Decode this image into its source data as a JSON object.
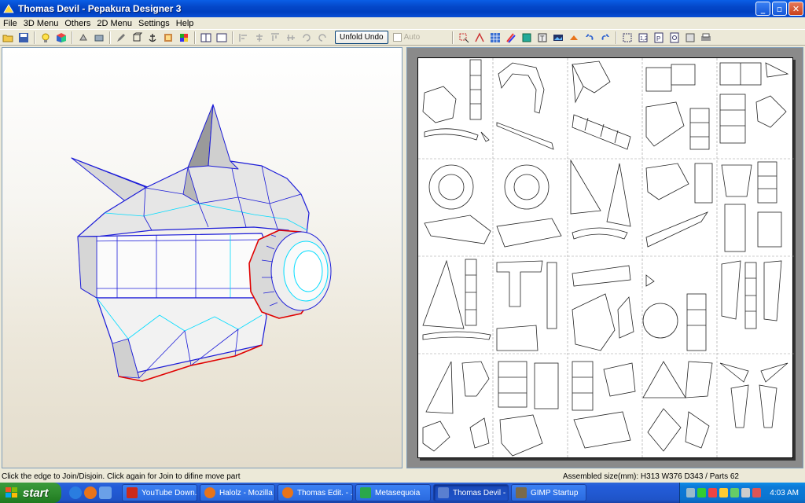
{
  "window": {
    "title": "Thomas Devil - Pepakura Designer 3"
  },
  "menu": [
    "File",
    "3D Menu",
    "Others",
    "2D Menu",
    "Settings",
    "Help"
  ],
  "toolbar": {
    "unfold_undo_label": "Unfold Undo",
    "auto_label": "Auto",
    "auto_checked": false
  },
  "status": {
    "left": "Click the edge to Join/Disjoin. Click again for Join to difine move part",
    "right": "Assembled size(mm): H313 W376 D343 / Parts 62"
  },
  "taskbar": {
    "start_label": "start",
    "tasks": [
      {
        "label": "YouTube Down...",
        "icon_color": "#cc2a1a",
        "active": false
      },
      {
        "label": "Halolz - Mozilla ...",
        "icon_color": "#e8741a",
        "active": false
      },
      {
        "label": "Thomas Edit. - ...",
        "icon_color": "#e8741a",
        "active": false
      },
      {
        "label": "Metasequoia",
        "icon_color": "#2aa84a",
        "active": false
      },
      {
        "label": "Thomas Devil - ...",
        "icon_color": "#5a7fd0",
        "active": true
      },
      {
        "label": "GIMP Startup",
        "icon_color": "#7a6a4a",
        "active": false
      }
    ],
    "clock": "4:03 AM"
  },
  "colors": {
    "titlebar": "#0447c8",
    "model_edge": "#0000cc",
    "fold_line": "#00e5ff",
    "selected_edge": "#e00000",
    "taskbar": "#245edb",
    "start": "#2f8c2f"
  }
}
